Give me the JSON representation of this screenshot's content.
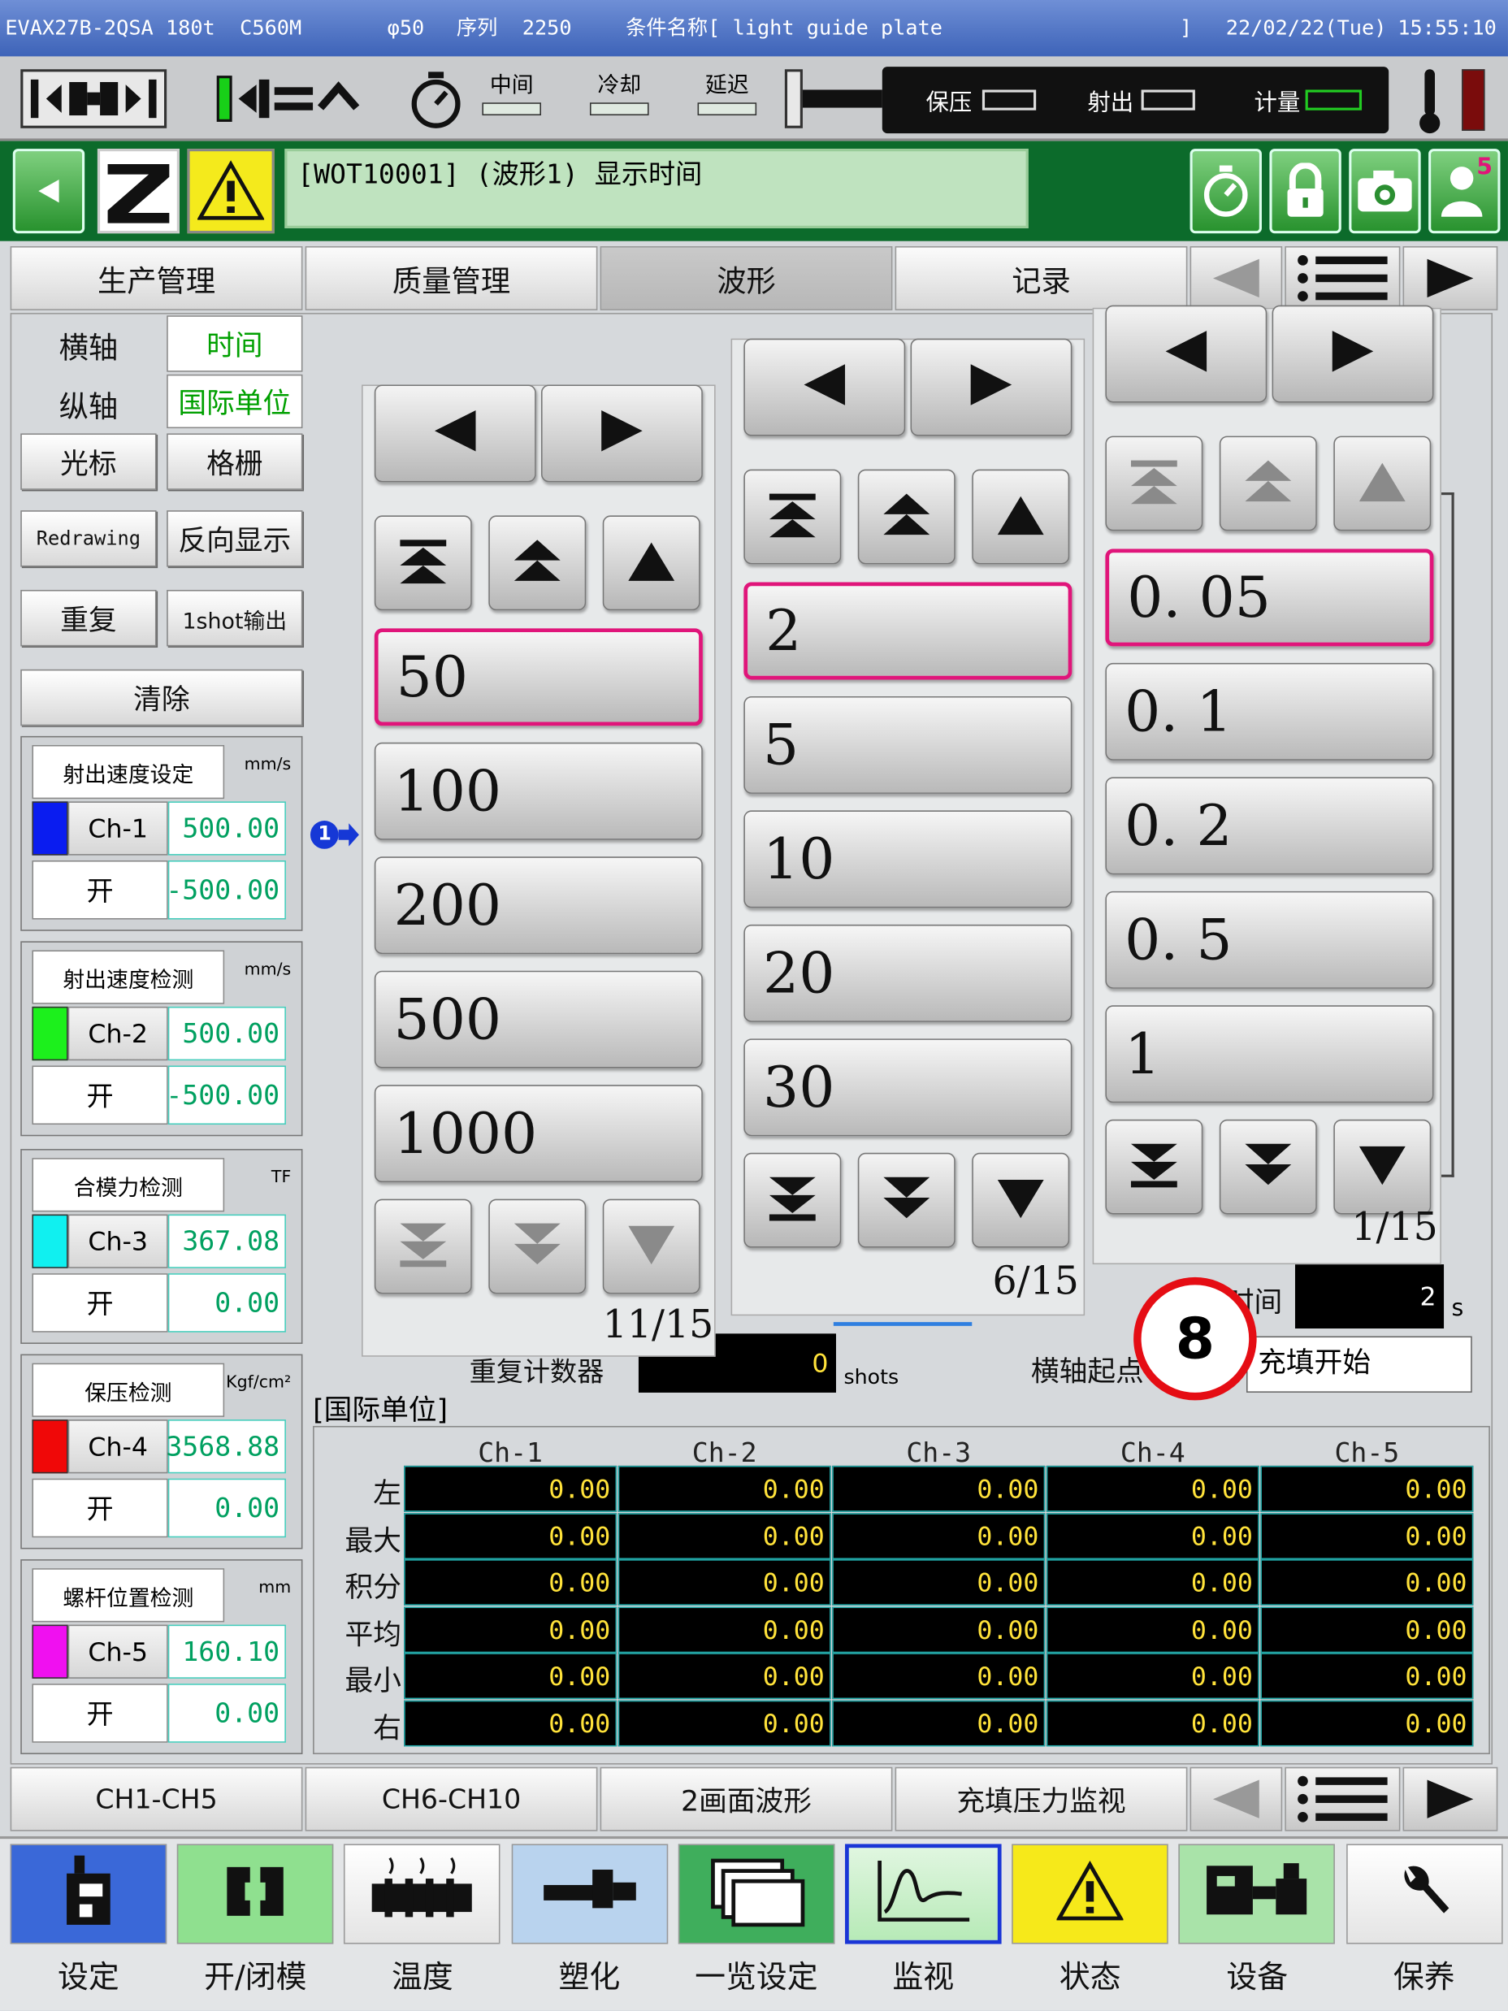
{
  "titlebar": {
    "machine": "EVAX27B-2QSA 180t  C560M",
    "diameter": "φ50",
    "sequence": "序列  2250",
    "condition_name": "条件名称[ light guide plate",
    "bracket_close": "]",
    "date": "22/02/22(Tue)",
    "time": "15:55:10"
  },
  "status": {
    "timers": [
      "中间",
      "冷却",
      "延迟"
    ],
    "bar_labels": [
      "保压",
      "射出",
      "计量"
    ]
  },
  "alarm": {
    "message": "[WOT10001]  (波形1) 显示时间",
    "user_badge": "5"
  },
  "top_tabs": [
    "生产管理",
    "质量管理",
    "波形",
    "记录"
  ],
  "left": {
    "haxis_label": "横轴",
    "haxis_value": "时间",
    "vaxis_label": "纵轴",
    "vaxis_value": "国际单位",
    "cursor": "光标",
    "grid": "格栅",
    "redrawing": "Redrawing",
    "reverse": "反向显示",
    "repeat": "重复",
    "oneshot": "1shot输出",
    "clear": "清除"
  },
  "channels": [
    {
      "title": "射出速度设定",
      "unit": "mm/s",
      "ch": "Ch-1",
      "color": "#0a1cf0",
      "max": "500.00",
      "open": "开",
      "min": "-500.00"
    },
    {
      "title": "射出速度检测",
      "unit": "mm/s",
      "ch": "Ch-2",
      "color": "#1cf01c",
      "max": "500.00",
      "open": "开",
      "min": "-500.00"
    },
    {
      "title": "合模力检测",
      "unit": "TF",
      "ch": "Ch-3",
      "color": "#10f0f0",
      "max": "367.08",
      "open": "开",
      "min": "0.00"
    },
    {
      "title": "保压检测",
      "unit": "Kgf/cm²",
      "ch": "Ch-4",
      "color": "#f00808",
      "max": "3568.88",
      "open": "开",
      "min": "0.00"
    },
    {
      "title": "螺杆位置检测",
      "unit": "mm",
      "ch": "Ch-5",
      "color": "#f010f0",
      "max": "160.10",
      "open": "开",
      "min": "0.00"
    }
  ],
  "popups": [
    {
      "options": [
        "50",
        "100",
        "200",
        "500",
        "1000"
      ],
      "selected": "50",
      "page": "11/15"
    },
    {
      "options": [
        "2",
        "5",
        "10",
        "20",
        "30"
      ],
      "selected": "2",
      "page": "6/15"
    },
    {
      "options": [
        "0. 05",
        "0. 1",
        "0. 2",
        "0. 5",
        "1"
      ],
      "selected": "0. 05",
      "page": "1/15"
    }
  ],
  "graph": {
    "marker": "1",
    "callout": "8",
    "time_label": "时间",
    "time_value": "2",
    "time_unit": "s",
    "counter_label": "重复计数器",
    "counter_value": "0",
    "counter_unit": "shots",
    "start_label": "横轴起点",
    "start_value": "充填开始"
  },
  "table": {
    "title": "[国际单位]",
    "columns": [
      "Ch-1",
      "Ch-2",
      "Ch-3",
      "Ch-4",
      "Ch-5"
    ],
    "rows": [
      {
        "label": "左",
        "values": [
          "0.00",
          "0.00",
          "0.00",
          "0.00",
          "0.00"
        ]
      },
      {
        "label": "最大",
        "values": [
          "0.00",
          "0.00",
          "0.00",
          "0.00",
          "0.00"
        ]
      },
      {
        "label": "积分",
        "values": [
          "0.00",
          "0.00",
          "0.00",
          "0.00",
          "0.00"
        ]
      },
      {
        "label": "平均",
        "values": [
          "0.00",
          "0.00",
          "0.00",
          "0.00",
          "0.00"
        ]
      },
      {
        "label": "最小",
        "values": [
          "0.00",
          "0.00",
          "0.00",
          "0.00",
          "0.00"
        ]
      },
      {
        "label": "右",
        "values": [
          "0.00",
          "0.00",
          "0.00",
          "0.00",
          "0.00"
        ]
      }
    ]
  },
  "bottom_tabs": [
    "CH1-CH5",
    "CH6-CH10",
    "2画面波形",
    "充填压力监视"
  ],
  "nav": [
    {
      "label": "设定",
      "icon": "setting-icon",
      "bg": "#3a68d8"
    },
    {
      "label": "开/闭模",
      "icon": "mold-icon",
      "bg": "#8fe08f"
    },
    {
      "label": "温度",
      "icon": "heater-icon",
      "bg": "#ffffff"
    },
    {
      "label": "塑化",
      "icon": "plasticize-icon",
      "bg": "#b9d3ee"
    },
    {
      "label": "一览设定",
      "icon": "list-setting-icon",
      "bg": "#3fae5c"
    },
    {
      "label": "监视",
      "icon": "monitor-icon",
      "bg": "#c8f0c8"
    },
    {
      "label": "状态",
      "icon": "warning-icon",
      "bg": "#f6e91a"
    },
    {
      "label": "设备",
      "icon": "equipment-icon",
      "bg": "#a9e3a9"
    },
    {
      "label": "保养",
      "icon": "wrench-icon",
      "bg": "#ffffff"
    }
  ]
}
